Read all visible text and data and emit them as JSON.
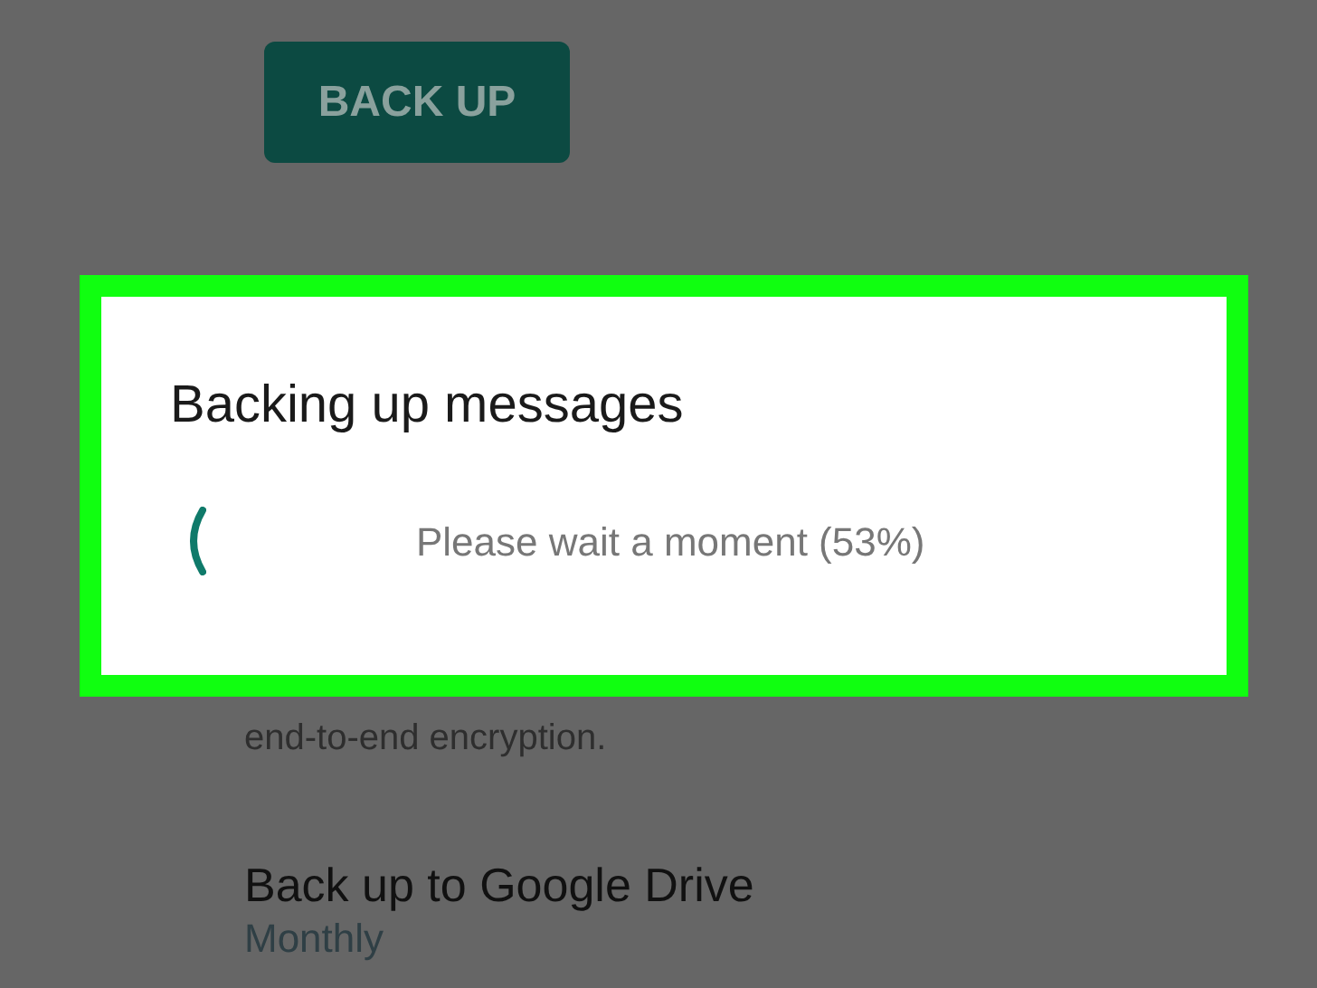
{
  "backup_button": {
    "label": "BACK UP"
  },
  "encryption_text": "end-to-end encryption.",
  "setting": {
    "title": "Back up to Google Drive",
    "value": "Monthly"
  },
  "dialog": {
    "title": "Backing up messages",
    "message": "Please wait a moment (53%)"
  }
}
